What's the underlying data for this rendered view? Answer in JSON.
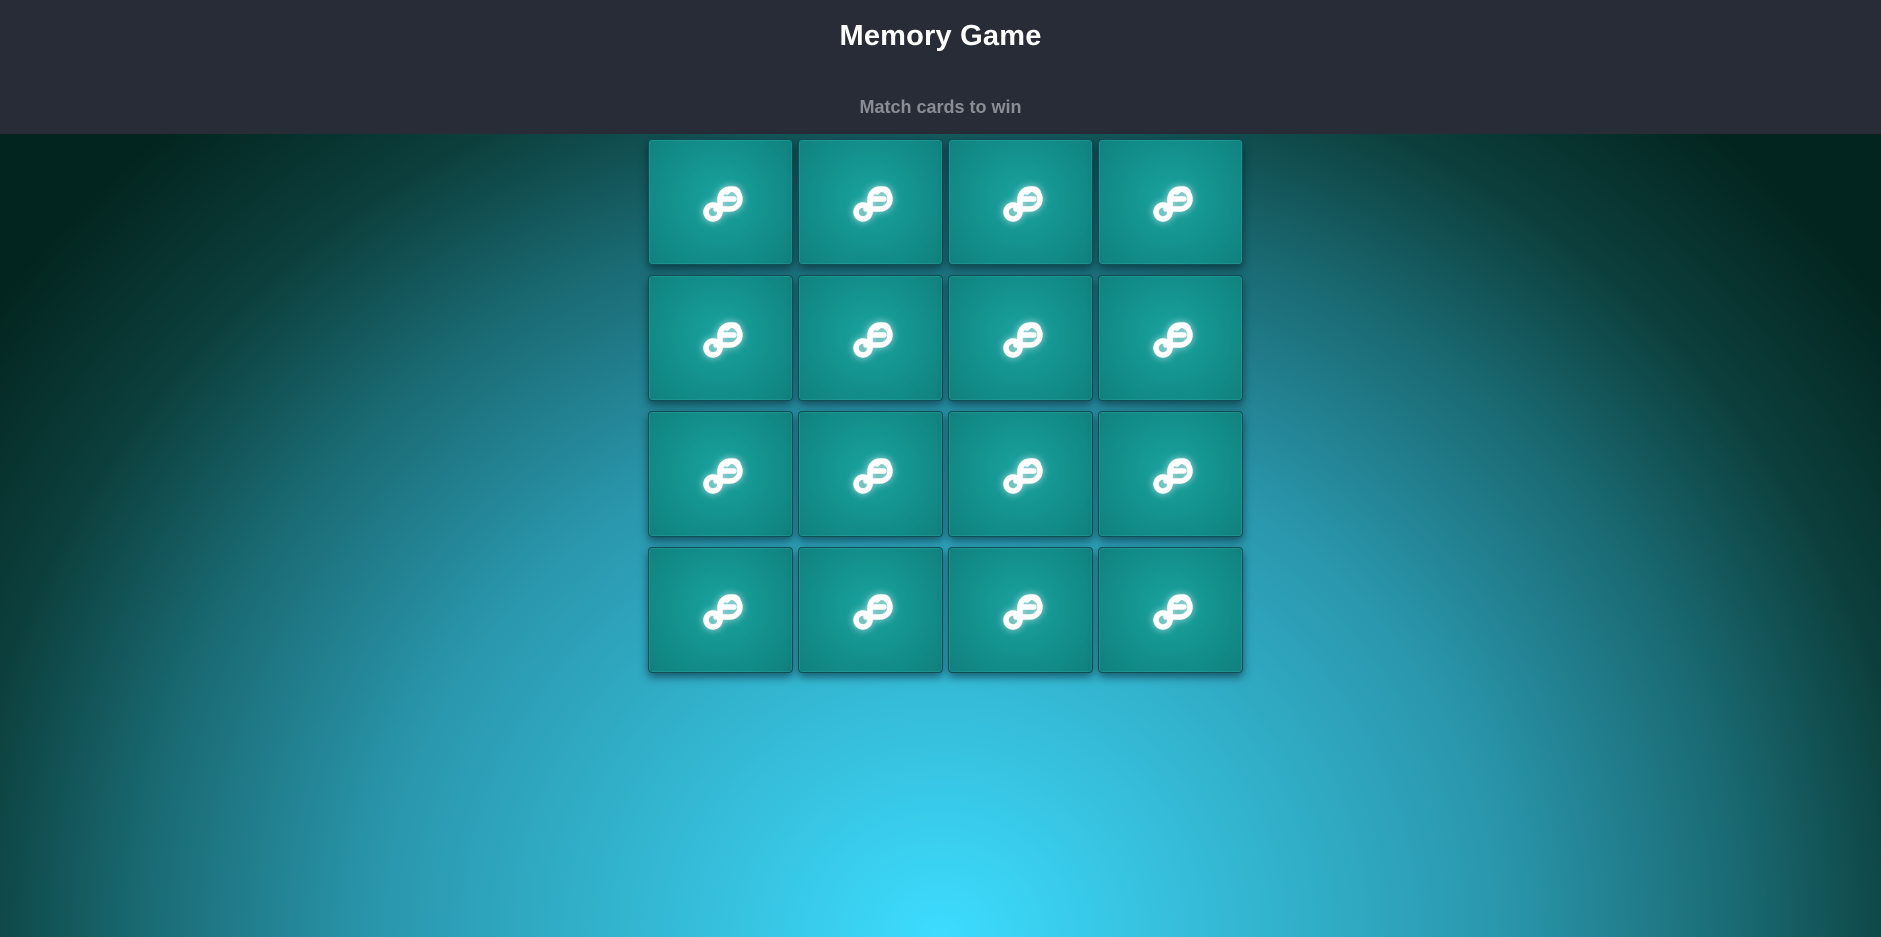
{
  "header": {
    "title": "Memory Game",
    "subtitle": "Match cards to win"
  },
  "board": {
    "rows": 4,
    "columns": 4,
    "cards": [
      {
        "face": "down",
        "icon": "fedora-logo-icon"
      },
      {
        "face": "down",
        "icon": "fedora-logo-icon"
      },
      {
        "face": "down",
        "icon": "fedora-logo-icon"
      },
      {
        "face": "down",
        "icon": "fedora-logo-icon"
      },
      {
        "face": "down",
        "icon": "fedora-logo-icon"
      },
      {
        "face": "down",
        "icon": "fedora-logo-icon"
      },
      {
        "face": "down",
        "icon": "fedora-logo-icon"
      },
      {
        "face": "down",
        "icon": "fedora-logo-icon"
      },
      {
        "face": "down",
        "icon": "fedora-logo-icon"
      },
      {
        "face": "down",
        "icon": "fedora-logo-icon"
      },
      {
        "face": "down",
        "icon": "fedora-logo-icon"
      },
      {
        "face": "down",
        "icon": "fedora-logo-icon"
      },
      {
        "face": "down",
        "icon": "fedora-logo-icon"
      },
      {
        "face": "down",
        "icon": "fedora-logo-icon"
      },
      {
        "face": "down",
        "icon": "fedora-logo-icon"
      },
      {
        "face": "down",
        "icon": "fedora-logo-icon"
      }
    ]
  },
  "colors": {
    "header_bg": "#282c37",
    "title": "#ffffff",
    "subtitle": "#8a8d94",
    "card_bg": "#14938f",
    "card_icon": "#ffffff",
    "background_center": "#3ddcff",
    "background_edge": "#03251f"
  }
}
